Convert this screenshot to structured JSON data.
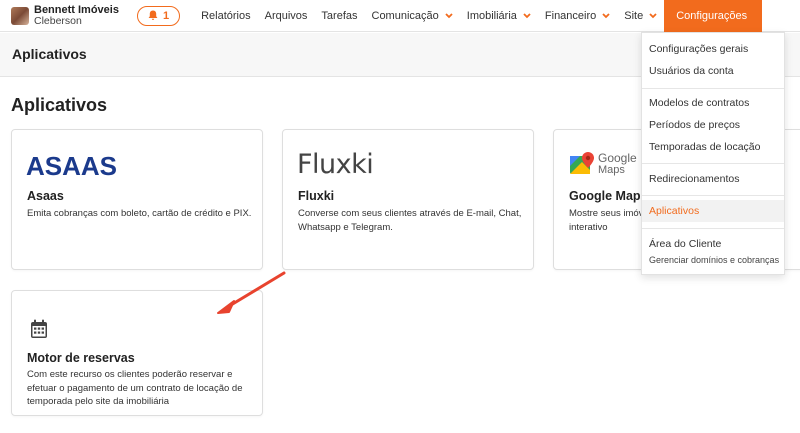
{
  "brand": {
    "name": "Bennett Imóveis",
    "user": "Cleberson"
  },
  "notifications": {
    "count": "1"
  },
  "nav": {
    "items": [
      {
        "label": "Relatórios",
        "dropdown": false
      },
      {
        "label": "Arquivos",
        "dropdown": false
      },
      {
        "label": "Tarefas",
        "dropdown": false
      },
      {
        "label": "Comunicação",
        "dropdown": true
      },
      {
        "label": "Imobiliária",
        "dropdown": true
      },
      {
        "label": "Financeiro",
        "dropdown": true
      },
      {
        "label": "Site",
        "dropdown": true
      }
    ],
    "active": "Configurações"
  },
  "subheader": {
    "title": "Aplicativos"
  },
  "page": {
    "title": "Aplicativos"
  },
  "cards": [
    {
      "logo_text": "ASAAS",
      "title": "Asaas",
      "description": "Emita cobranças com boleto, cartão de crédito e PIX."
    },
    {
      "logo_text": "Fluxki",
      "title": "Fluxki",
      "description": "Converse com seus clientes através de E-mail, Chat, Whatsapp e Telegram."
    },
    {
      "logo_text_1": "Google",
      "logo_text_2": "Maps",
      "title": "Google Maps",
      "description": "Mostre seus imóv interativo"
    },
    {
      "icon": "calendar-icon",
      "title": "Motor de reservas",
      "description": "Com este recurso os clientes poderão reservar e efetuar o pagamento de um contrato de locação de temporada pelo site da imobiliária"
    }
  ],
  "dropdown": {
    "items": [
      "Configurações gerais",
      "Usuários da conta",
      "Modelos de contratos",
      "Períodos de preços",
      "Temporadas de locação",
      "Redirecionamentos",
      "Aplicativos",
      "Área do Cliente"
    ],
    "sub_label": "Gerenciar domínios e cobranças",
    "active": "Aplicativos"
  },
  "colors": {
    "accent": "#f26b1d",
    "asaas": "#1b3a8c",
    "arrow": "#e8432e"
  }
}
